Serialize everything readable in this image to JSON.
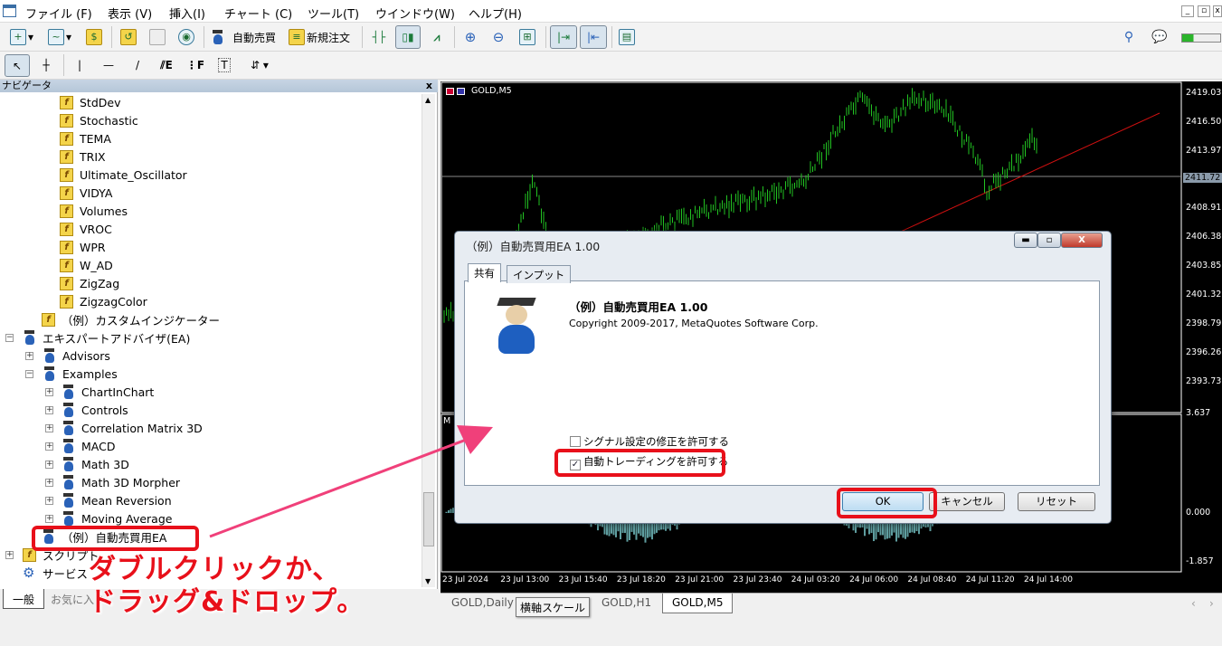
{
  "menu": [
    "ファイル (F)",
    "表示 (V)",
    "挿入(I)",
    "チャート (C)",
    "ツール(T)",
    "ウインドウ(W)",
    "ヘルプ(H)"
  ],
  "toolbar": {
    "auto_trading": "自動売買",
    "new_order": "新規注文"
  },
  "navigator": {
    "title": "ナビゲータ",
    "close": "x",
    "indicators": [
      "StdDev",
      "Stochastic",
      "TEMA",
      "TRIX",
      "Ultimate_Oscillator",
      "VIDYA",
      "Volumes",
      "VROC",
      "WPR",
      "W_AD",
      "ZigZag",
      "ZigzagColor"
    ],
    "custom_indicator": "（例）カスタムインジケーター",
    "ea_root": "エキスパートアドバイザ(EA)",
    "advisors": "Advisors",
    "examples": "Examples",
    "example_items": [
      "ChartInChart",
      "Controls",
      "Correlation Matrix 3D",
      "MACD",
      "Math 3D",
      "Math 3D Morpher",
      "Mean Reversion",
      "Moving Average"
    ],
    "sample_ea": "（例）自動売買用EA",
    "scripts": "スクリプト",
    "services": "サービス",
    "tabs": [
      "一般",
      "お気に入り"
    ]
  },
  "chart": {
    "symbol": "GOLD,M5",
    "sub_label": "M",
    "price_labels": [
      "2419.03",
      "2416.50",
      "2413.97",
      "2408.91",
      "2406.38",
      "2403.85",
      "2401.32",
      "2398.79",
      "2396.26",
      "2393.73"
    ],
    "current_price": "2411.72",
    "sub_labels": [
      "3.637",
      "0.000",
      "-1.857"
    ],
    "time_labels": [
      "23 Jul 2024",
      "23 Jul 13:00",
      "23 Jul 15:40",
      "23 Jul 18:20",
      "23 Jul 21:00",
      "23 Jul 23:40",
      "24 Jul 03:20",
      "24 Jul 06:00",
      "24 Jul 08:40",
      "24 Jul 11:20",
      "24 Jul 14:00"
    ],
    "tabs": [
      "GOLD,Daily",
      "GOLD,H1",
      "GOLD,M5"
    ],
    "active_tab": "GOLD,M5",
    "tooltip": "横軸スケール",
    "colors": {
      "candle": "#22c322",
      "trendline": "#d01010",
      "background": "#000000"
    }
  },
  "dialog": {
    "title": "（例）自動売買用EA 1.00",
    "tabs": [
      "共有",
      "インプット"
    ],
    "name": "（例）自動売買用EA 1.00",
    "copyright": "Copyright 2009-2017, MetaQuotes Software Corp.",
    "signal_checkbox": {
      "label": "シグナル設定の修正を許可する",
      "checked": false
    },
    "autotrade_checkbox": {
      "label": "自動トレーディングを許可する",
      "checked": true
    },
    "ok": "OK",
    "cancel": "キャンセル",
    "reset": "リセット"
  },
  "annotation": {
    "line1": "ダブルクリックか、",
    "line2": "ドラッグ&ドロップ。",
    "color": "#e8101a"
  }
}
